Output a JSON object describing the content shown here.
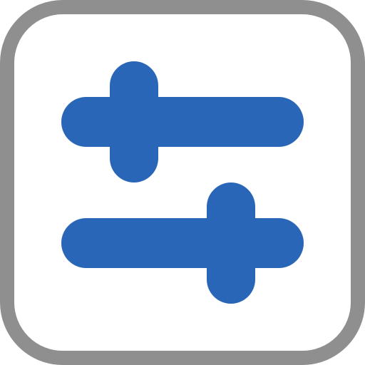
{
  "icon": {
    "name": "sliders-settings-icon",
    "colors": {
      "frame_fill": "#ffffff",
      "frame_stroke": "#8f8f8f",
      "glyph": "#2a66b8"
    }
  }
}
